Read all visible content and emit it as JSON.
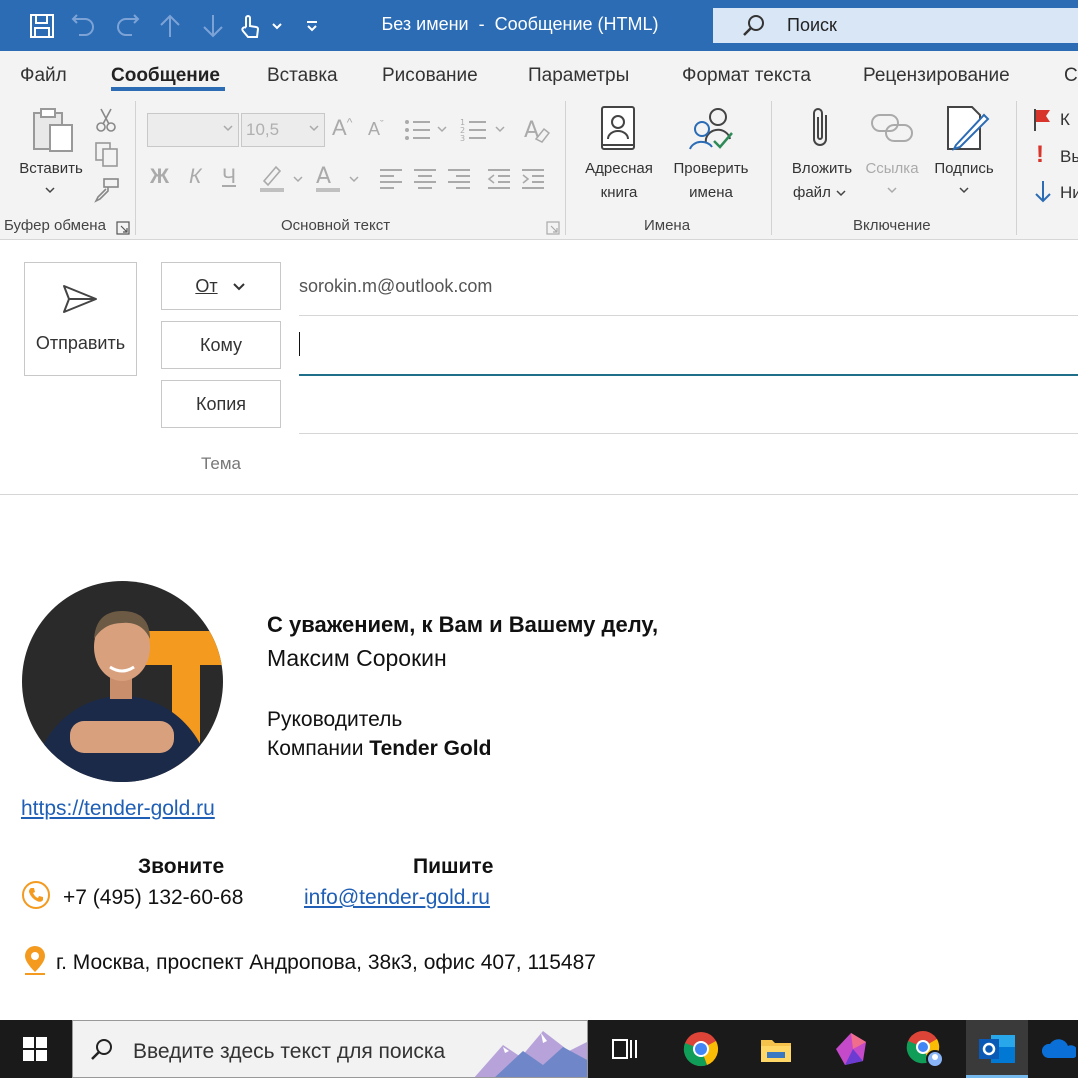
{
  "window": {
    "title": "Без имени  -  Сообщение (HTML)",
    "search_label": "Поиск"
  },
  "tabs": [
    {
      "label": "Файл"
    },
    {
      "label": "Сообщение",
      "active": true
    },
    {
      "label": "Вставка"
    },
    {
      "label": "Рисование"
    },
    {
      "label": "Параметры"
    },
    {
      "label": "Формат текста"
    },
    {
      "label": "Рецензирование"
    },
    {
      "label": "Сп"
    }
  ],
  "ribbon": {
    "clipboard": {
      "paste_label": "Вставить",
      "group_label": "Буфер обмена"
    },
    "basic_text": {
      "font_name": "",
      "font_size": "10,5",
      "bold": "Ж",
      "italic": "К",
      "underline": "Ч",
      "group_label": "Основной текст"
    },
    "names": {
      "address_book_line1": "Адресная",
      "address_book_line2": "книга",
      "check_names_line1": "Проверить",
      "check_names_line2": "имена",
      "group_label": "Имена"
    },
    "include": {
      "attach_line1": "Вложить",
      "attach_line2": "файл",
      "link_label": "Ссылка",
      "signature_label": "Подпись",
      "group_label": "Включение"
    },
    "tags": {
      "followup": "К",
      "importance": "Вы",
      "low": "Ни"
    }
  },
  "header": {
    "send_label": "Отправить",
    "from_label": "От",
    "from_value": "sorokin.m@outlook.com",
    "to_label": "Кому",
    "to_value": "",
    "cc_label": "Копия",
    "cc_value": "",
    "subject_label": "Тема",
    "subject_value": ""
  },
  "signature": {
    "greeting": "С уважением, к Вам и Вашему делу,",
    "name": "Максим Сорокин",
    "position_line1": "Руководитель",
    "position_prefix": "Компании ",
    "company": "Tender Gold",
    "website": "https://tender-gold.ru",
    "call_heading": "Звоните",
    "write_heading": "Пишите",
    "phone": "+7 (495) 132-60-68",
    "email": "info@tender-gold.ru",
    "address": "г. Москва, проспект Андропова, 38к3, офис 407, 115487"
  },
  "taskbar": {
    "search_placeholder": "Введите здесь текст для поиска",
    "apps": [
      "task-view-icon",
      "chrome-icon",
      "file-explorer-icon",
      "app-icon",
      "chrome-profile-icon",
      "outlook-icon",
      "onedrive-icon"
    ]
  },
  "colors": {
    "accent": "#2b6cb5",
    "link": "#1f5fb5",
    "orange": "#f39a1f"
  }
}
